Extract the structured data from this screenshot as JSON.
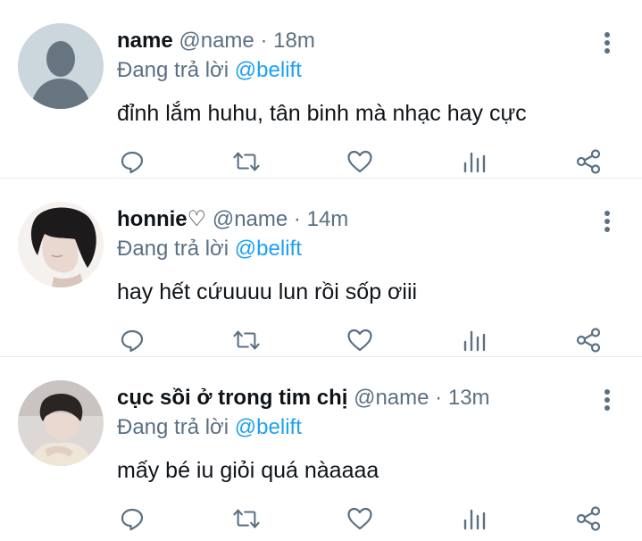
{
  "colors": {
    "icon": "#5b7083",
    "mention": "#1da1f2",
    "text": "#0f1419",
    "divider": "#e6ecf0"
  },
  "replies": [
    {
      "name": "name",
      "handle": "@name",
      "separator": "·",
      "time": "18m",
      "reply_prefix": "Đang trả lời",
      "reply_to": "@belift",
      "text": "đỉnh lắm huhu, tân binh mà nhạc hay cực",
      "avatar": "default-avatar-icon"
    },
    {
      "name": "honnie♡",
      "handle": "@name",
      "separator": "·",
      "time": "14m",
      "reply_prefix": "Đang trả lời",
      "reply_to": "@belift",
      "text": "hay hết cứuuuu lun rồi sốp ơiii",
      "avatar": "profile-photo"
    },
    {
      "name": "cục sồi ở trong tim chị",
      "handle": "@name",
      "separator": "·",
      "time": "13m",
      "reply_prefix": "Đang trả lời",
      "reply_to": "@belift",
      "text": "mấy bé iu giỏi quá nàaaaa",
      "avatar": "profile-photo"
    }
  ]
}
